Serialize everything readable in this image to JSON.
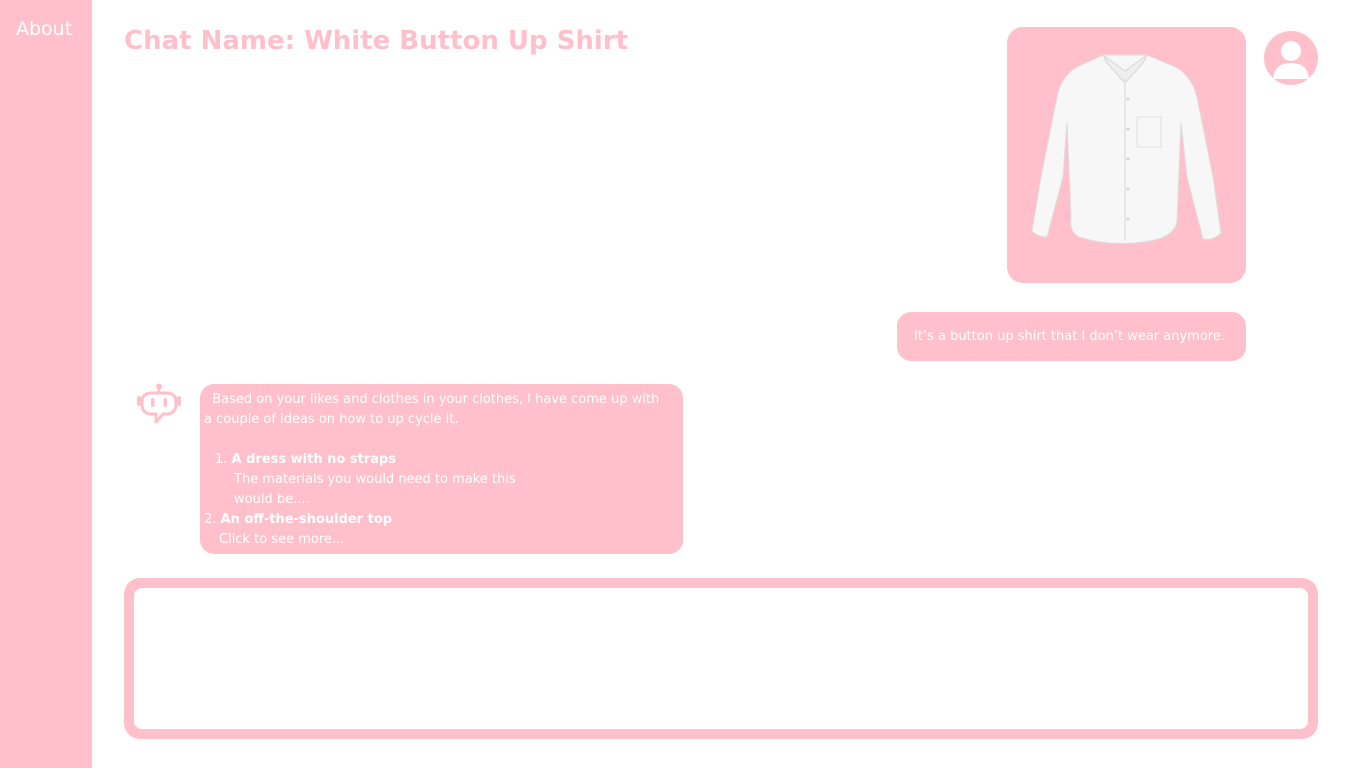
{
  "sidebar": {
    "about_label": "About"
  },
  "header": {
    "title": "Chat Name: White Button Up Shirt"
  },
  "messages": {
    "user_image_icon": "white-button-up-shirt-image",
    "user_text": "It’s a button up shirt that I don’t wear anymore.",
    "bot": {
      "intro_line1": "  Based on your likes and clothes in your clothes, I have come up with",
      "intro_line2": "a couple of ideas on how to up cycle it.",
      "item1_number": "1.",
      "item1_title": "A dress with no straps",
      "item1_desc_line1": "The materials you would need to make this",
      "item1_desc_line2": "would be....",
      "item2_number": "2.",
      "item2_title": "An off-the-shoulder top",
      "item2_more": "Click to see more..."
    }
  },
  "composer": {
    "value": "",
    "placeholder": ""
  },
  "icons": {
    "avatar": "user-avatar-icon",
    "bot": "robot-chat-icon"
  },
  "colors": {
    "accent": "#ffc0cb",
    "background": "#ffffff",
    "text_on_accent": "#ffffff"
  }
}
